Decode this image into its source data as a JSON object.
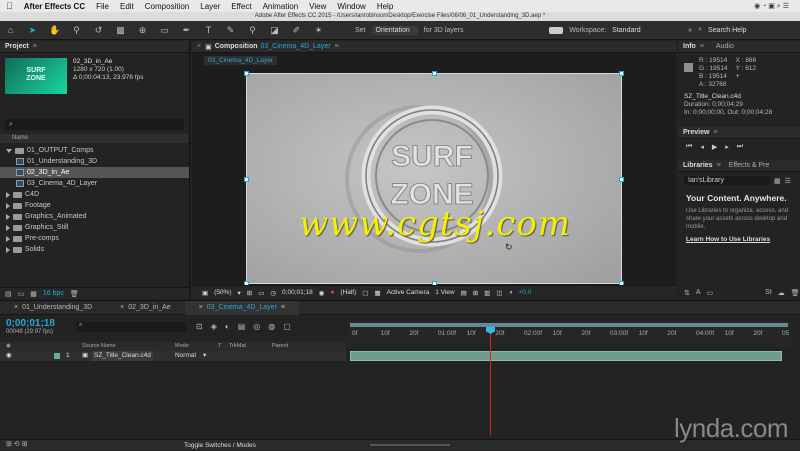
{
  "menubar": {
    "apple": "",
    "app": "After Effects CC",
    "items": [
      "File",
      "Edit",
      "Composition",
      "Layer",
      "Effect",
      "Animation",
      "View",
      "Window",
      "Help"
    ]
  },
  "window_title": "Adobe After Effects CC 2015 - /Users/ianrobinson/Desktop/Exercise Files/06/06_01_Understanding_3D.aep *",
  "toolbar": {
    "set_label": "Set",
    "orientation": "Orientation",
    "for3d": "for 3D layers",
    "workspace_label": "Workspace:",
    "workspace_value": "Standard",
    "search_help": "Search Help"
  },
  "project": {
    "title": "Project",
    "item_name": "02_3D_in_Ae",
    "item_res": "1280 x 720 (1.00)",
    "item_dur": "Δ 0;00:04:13, 23.976 fps",
    "search_placeholder": "",
    "col_name": "Name",
    "tree": [
      {
        "label": "01_OUTPUT_Comps",
        "type": "folder",
        "open": true,
        "indent": 0
      },
      {
        "label": "01_Understanding_3D",
        "type": "comp",
        "indent": 1
      },
      {
        "label": "02_3D_in_Ae",
        "type": "comp",
        "indent": 1,
        "selected": true
      },
      {
        "label": "03_Cinema_4D_Layer",
        "type": "comp",
        "indent": 1
      },
      {
        "label": "C4D",
        "type": "folder",
        "indent": 0
      },
      {
        "label": "Footage",
        "type": "folder",
        "indent": 0
      },
      {
        "label": "Graphics_Animated",
        "type": "folder",
        "indent": 0
      },
      {
        "label": "Graphics_Still",
        "type": "folder",
        "indent": 0
      },
      {
        "label": "Pre-comps",
        "type": "folder",
        "indent": 0
      },
      {
        "label": "Solids",
        "type": "folder",
        "indent": 0
      }
    ],
    "bpc": "16 bpc"
  },
  "composition": {
    "title": "Composition",
    "name": "03_Cinema_4D_Layer",
    "tab": "03_Cinema_4D_Layer",
    "zoom": "(50%)",
    "timecode": "0;00;01;18",
    "res": "(Half)",
    "camera": "Active Camera",
    "views": "1 View",
    "exposure": "+0.0",
    "logo_line1": "SURF",
    "logo_line2": "ZONE"
  },
  "watermark": "www.cgtsj.com",
  "info": {
    "tab1": "Info",
    "tab2": "Audio",
    "r": "R : 19514",
    "g": "G : 19514",
    "b": "B : 19514",
    "a": "A : 32768",
    "x": "X : 868",
    "y": "Y : 612",
    "layer": "SZ_Title_Clean.c4d",
    "duration": "Duration: 0;00;04;29",
    "inout": "In: 0;00;00;00, Out: 0;00;04;28"
  },
  "preview": {
    "title": "Preview"
  },
  "libraries": {
    "tab1": "Libraries",
    "tab2": "Effects & Pre",
    "library": "Ian'sLibrary",
    "headline": "Your Content. Anywhere.",
    "body": "Use Libraries to organize, access, and share your assets across desktop and mobile.",
    "link": "Learn How to Use Libraries"
  },
  "timeline": {
    "tabs": [
      "01_Understanding_3D",
      "02_3D_in_Ae",
      "03_Cinema_4D_Layer"
    ],
    "timecode": "0;00;01;18",
    "frames": "00048 (29.97 fps)",
    "cols": {
      "source": "Source Name",
      "mode": "Mode",
      "t": "T",
      "trkmat": "TrkMat",
      "parent": "Parent"
    },
    "layer": {
      "num": "1",
      "name": "SZ_Title_Clean.c4d",
      "mode": "Normal"
    },
    "ruler": [
      "0f",
      "10f",
      "20f",
      "01:00f",
      "10f",
      "20f",
      "02:00f",
      "10f",
      "20f",
      "03:00f",
      "10f",
      "20f",
      "04:00f",
      "10f",
      "20f",
      "05"
    ],
    "toggle": "Toggle Switches / Modes"
  },
  "brand": "lynda.com"
}
